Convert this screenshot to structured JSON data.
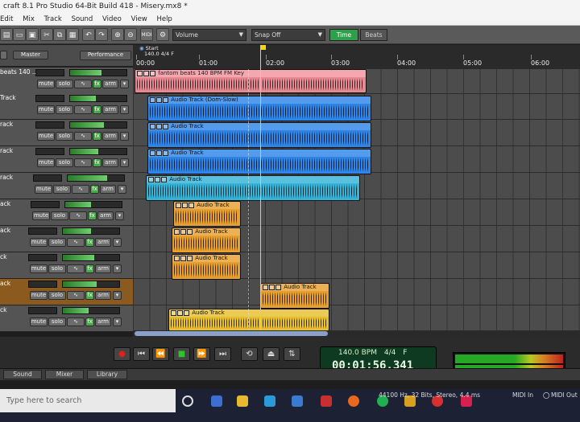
{
  "window": {
    "title": "craft 8.1 Pro Studio 64-Bit Build 418 - Misery.mx8 *"
  },
  "menu": {
    "items": [
      "Edit",
      "Mix",
      "Track",
      "Sound",
      "Video",
      "View",
      "Help"
    ]
  },
  "toolbar": {
    "volume_select": "Volume",
    "snap_select": "Snap Off",
    "time_toggle": "Time",
    "beats_toggle": "Beats",
    "midi_badge": "MIDI"
  },
  "track_header": {
    "master_label": "Master",
    "performance_button": "Performance"
  },
  "ruler": {
    "start_label": "Start",
    "tempo_marker": "140.0 4/4 F",
    "ticks": [
      "00:00",
      "01:00",
      "02:00",
      "03:00",
      "04:00",
      "05:00",
      "06:00"
    ]
  },
  "track_buttons": {
    "mute": "mute",
    "solo": "solo",
    "fx": "fx",
    "arm": "arm"
  },
  "tracks": [
    {
      "name": "beats 140 ..."
    },
    {
      "name": "Track"
    },
    {
      "name": "rack"
    },
    {
      "name": "rack"
    },
    {
      "name": "rack"
    },
    {
      "name": "ack"
    },
    {
      "name": "ack"
    },
    {
      "name": "ck"
    },
    {
      "name": "ack"
    },
    {
      "name": "ck"
    }
  ],
  "clips": [
    {
      "label": "fantom beats 140 BPM FM Key",
      "color": "#e88a94"
    },
    {
      "label": "Audio Track (Dom-Slow)",
      "color": "#2f86e8"
    },
    {
      "label": "Audio Track",
      "color": "#2f86e8"
    },
    {
      "label": "Audio Track",
      "color": "#2f86e8"
    },
    {
      "label": "Audio Track",
      "color": "#35b4d8"
    },
    {
      "label": "Audio Track",
      "color": "#e8a030"
    },
    {
      "label": "Audio Track",
      "color": "#e8a030"
    },
    {
      "label": "Audio Track",
      "color": "#e8a030"
    },
    {
      "label": "Audio Track",
      "color": "#e8a030"
    },
    {
      "label": "Audio Track",
      "color": "#e8c030"
    }
  ],
  "transport": {
    "tempo": "140.0 BPM",
    "signature": "4/4",
    "key": "F",
    "time": "00:01:56.341"
  },
  "bottom_tabs": [
    "Sound",
    "Mixer",
    "Library"
  ],
  "status": {
    "audio_format": "44100 Hz, 32 Bits, Stereo, 4.4 ms",
    "midi_in": "MIDI In",
    "midi_out": "MIDI Out"
  },
  "taskbar": {
    "search_placeholder": "Type here to search"
  },
  "colors": {
    "accent": "#f2d51a",
    "fx_green": "#4aa84a",
    "lcd_green": "#0e3a22"
  }
}
